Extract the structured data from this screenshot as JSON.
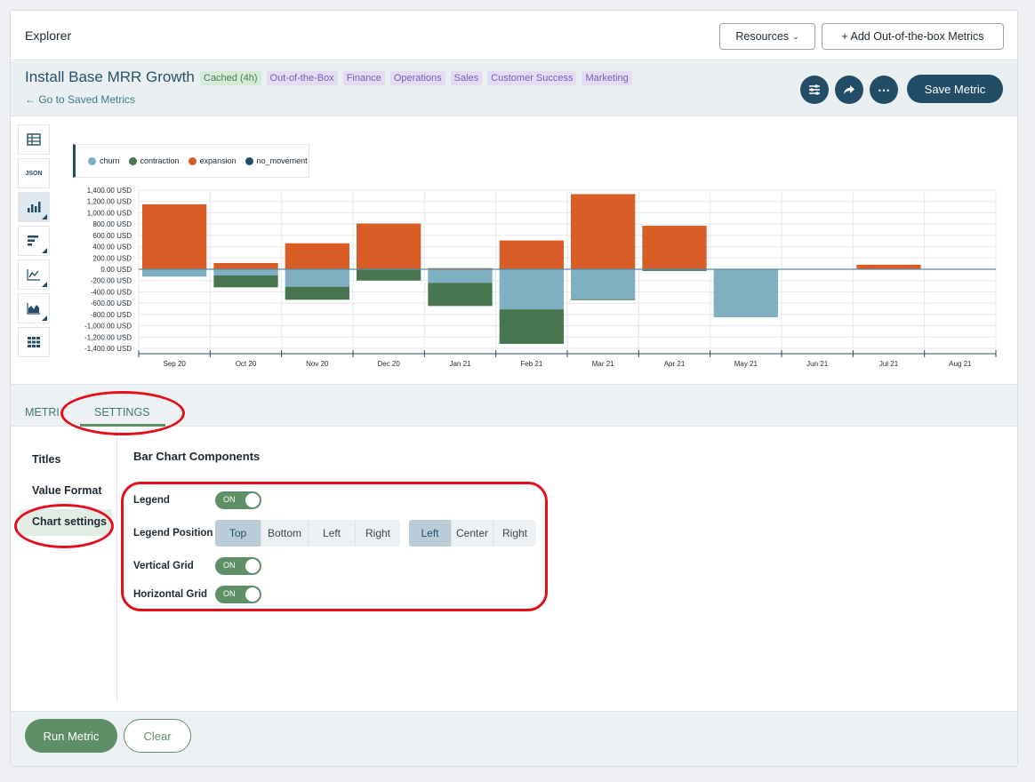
{
  "topbar": {
    "title": "Explorer",
    "resources_label": "Resources",
    "add_metrics_label": "+ Add Out-of-the-box Metrics"
  },
  "metric": {
    "title": "Install Base MRR Growth",
    "back_link": "← Go to Saved Metrics",
    "tags": [
      {
        "label": "Cached (4h)",
        "kind": "cached"
      },
      {
        "label": "Out-of-the-Box",
        "kind": "purple"
      },
      {
        "label": "Finance",
        "kind": "purple"
      },
      {
        "label": "Operations",
        "kind": "purple"
      },
      {
        "label": "Sales",
        "kind": "purple"
      },
      {
        "label": "Customer Success",
        "kind": "purple"
      },
      {
        "label": "Marketing",
        "kind": "purple"
      }
    ],
    "save_label": "Save Metric",
    "more_icon": "⋯"
  },
  "viz_tools": {
    "json_label": "JSON"
  },
  "chart_data": {
    "type": "bar",
    "stacked": true,
    "categories": [
      "Sep 20",
      "Oct 20",
      "Nov 20",
      "Dec 20",
      "Jan 21",
      "Feb 21",
      "Mar 21",
      "Apr 21",
      "May 21",
      "Jun 21",
      "Jul 21",
      "Aug 21"
    ],
    "series": [
      {
        "name": "churn",
        "color": "#7fb0c2",
        "values": [
          -130,
          -110,
          -310,
          -10,
          -240,
          -710,
          -530,
          -10,
          -850,
          0,
          0,
          0
        ]
      },
      {
        "name": "contraction",
        "color": "#477550",
        "values": [
          0,
          -210,
          -230,
          -190,
          -410,
          -610,
          -10,
          -20,
          0,
          0,
          0,
          0
        ]
      },
      {
        "name": "expansion",
        "color": "#d95d26",
        "values": [
          1150,
          110,
          460,
          810,
          20,
          510,
          1330,
          770,
          0,
          0,
          80,
          0
        ]
      },
      {
        "name": "no_movement",
        "color": "#234c66",
        "values": [
          0,
          0,
          0,
          0,
          0,
          0,
          0,
          0,
          0,
          0,
          0,
          0
        ]
      }
    ],
    "ylim": [
      -1400,
      1400
    ],
    "yticks": [
      "1,400.00 USD",
      "1,200.00 USD",
      "1,000.00 USD",
      "800.00 USD",
      "600.00 USD",
      "400.00 USD",
      "200.00 USD",
      "0.00 USD",
      "-200.00 USD",
      "-400.00 USD",
      "-600.00 USD",
      "-800.00 USD",
      "-1,000.00 USD",
      "-1,200.00 USD",
      "-1,400.00 USD"
    ],
    "grid": {
      "vertical": true,
      "horizontal": true
    },
    "legend_position": "top-left"
  },
  "tabs": {
    "metrics_label": "METRI",
    "settings_label": "SETTINGS"
  },
  "settings": {
    "nav": [
      "Titles",
      "Value Format",
      "Chart settings"
    ],
    "section_title": "Bar Chart Components",
    "legend_label": "Legend",
    "legend_position_label": "Legend Position",
    "vertical_grid_label": "Vertical Grid",
    "horizontal_grid_label": "Horizontal Grid",
    "toggle_on_text": "ON",
    "position_options": [
      "Top",
      "Bottom",
      "Left",
      "Right"
    ],
    "position_selected": "Top",
    "align_options": [
      "Left",
      "Center",
      "Right"
    ],
    "align_selected": "Left"
  },
  "footer": {
    "run_label": "Run Metric",
    "clear_label": "Clear"
  }
}
